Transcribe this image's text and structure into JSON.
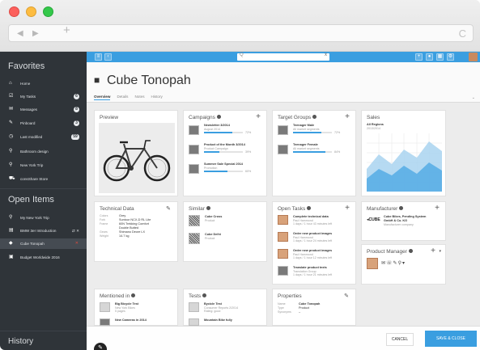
{
  "browser": {
    "back": "◀",
    "forward": "▶",
    "new_tab": "+",
    "reload": "C"
  },
  "sidebar": {
    "favorites_heading": "Favorites",
    "favorites": [
      {
        "icon": "home-icon",
        "glyph": "⌂",
        "label": "Home",
        "badge": ""
      },
      {
        "icon": "tasks-icon",
        "glyph": "☑",
        "label": "My Tasks",
        "badge": "6"
      },
      {
        "icon": "mail-icon",
        "glyph": "✉",
        "label": "Messages",
        "badge": "8"
      },
      {
        "icon": "pin-icon",
        "glyph": "✎",
        "label": "Pinboard",
        "badge": "3"
      },
      {
        "icon": "clock-icon",
        "glyph": "◷",
        "label": "Last modified",
        "badge": "59"
      },
      {
        "icon": "search-icon",
        "glyph": "⚲",
        "label": "Bathroom design",
        "badge": ""
      },
      {
        "icon": "search-icon",
        "glyph": "⚲",
        "label": "New York Trip",
        "badge": ""
      },
      {
        "icon": "cart-icon",
        "glyph": "⛟",
        "label": "consShare Store",
        "badge": ""
      }
    ],
    "open_items_heading": "Open Items",
    "open_items": [
      {
        "icon": "search-icon",
        "glyph": "⚲",
        "label": "My New York Trip"
      },
      {
        "icon": "page-icon",
        "glyph": "▤",
        "label": "BMW 3er Introduction"
      },
      {
        "icon": "cube-icon",
        "glyph": "◆",
        "label": "Cube Tonopah"
      },
      {
        "icon": "report-icon",
        "glyph": "▣",
        "label": "Budget Worldwide 2016"
      }
    ],
    "history_heading": "History"
  },
  "topbar": {
    "search_placeholder": "Q",
    "clear": "x"
  },
  "header": {
    "title": "Cube Tonopah",
    "tabs": [
      "Overview",
      "Details",
      "Notes",
      "History"
    ]
  },
  "cards": {
    "preview": {
      "title": "Preview"
    },
    "campaigns": {
      "title": "Campaigns",
      "items": [
        {
          "name": "Newsletter 3/2014",
          "sub": "August 2014",
          "pct": "72%",
          "fill": 0.72
        },
        {
          "name": "Product of the Month 3/2014",
          "sub": "Product Campaign",
          "pct": "39%",
          "fill": 0.39
        },
        {
          "name": "Summer Sale Special 2014",
          "sub": "Promotion",
          "pct": "60%",
          "fill": 0.6
        }
      ]
    },
    "target_groups": {
      "title": "Target Groups",
      "items": [
        {
          "name": "Teenager Male",
          "sub": "All market segments",
          "pct": "72%",
          "fill": 0.72
        },
        {
          "name": "Teenager Female",
          "sub": "All market segments",
          "pct": "84%",
          "fill": 0.84
        }
      ]
    },
    "sales": {
      "title": "Sales",
      "region": "All Regions",
      "period": "2013/2014"
    },
    "technical": {
      "title": "Technical Data",
      "rows": [
        {
          "k": "Colors",
          "v": "Grey"
        },
        {
          "k": "Fork",
          "v": "Suntour NCX-D RL Lite"
        },
        {
          "k": "Frame",
          "v": "60N Trekking Comfort"
        },
        {
          "k": "",
          "v": "Double Butted"
        },
        {
          "k": "Gears",
          "v": "Shimano Deore LX"
        },
        {
          "k": "Weight",
          "v": "14.7 kg"
        }
      ]
    },
    "similar": {
      "title": "Similar",
      "items": [
        {
          "name": "Cube Cross",
          "sub": "Product"
        },
        {
          "name": "Cube Delhi",
          "sub": "Product"
        }
      ]
    },
    "open_tasks": {
      "title": "Open Tasks",
      "items": [
        {
          "name": "Complete technical data",
          "sub1": "Paul Hammond",
          "sub2": "1 days / 1 hour 43 minutes left"
        },
        {
          "name": "Order new product images",
          "sub1": "Paul Hammond",
          "sub2": "1 days / 1 hour 24 minutes left"
        },
        {
          "name": "Order new product images",
          "sub1": "Paul Hammond",
          "sub2": "1 days / 1 hour 12 minutes left"
        },
        {
          "name": "Translate product texts",
          "sub1": "Translation Group",
          "sub2": "1 days / 1 hour 21 minutes left"
        }
      ]
    },
    "manufacturer": {
      "title": "Manufacturer",
      "name": "Cube Bikes, Pending System",
      "name2": "GmbH & Co. KG",
      "sub": "Manufacturer company"
    },
    "product_manager": {
      "title": "Product Manager"
    },
    "mentioned": {
      "title": "Mentioned in",
      "items": [
        {
          "name": "Big Bicycle Test",
          "sub1": "New York Bikes",
          "sub2": "5 pages"
        },
        {
          "name": "New Cameras in 2014",
          "sub1": "",
          "sub2": ""
        }
      ]
    },
    "tests": {
      "title": "Tests",
      "items": [
        {
          "name": "Bycicle Test",
          "sub1": "Consumer Reports 2/2014",
          "sub2": "Rating: good"
        },
        {
          "name": "Mountain Bike fully",
          "sub1": "",
          "sub2": ""
        }
      ]
    },
    "properties": {
      "title": "Properties",
      "rows": [
        {
          "k": "Name",
          "v": "Cube Tonopah"
        },
        {
          "k": "Type",
          "v": "Product"
        },
        {
          "k": "Synonyms",
          "v": "–"
        }
      ]
    }
  },
  "footer": {
    "cancel": "CANCEL",
    "save": "SAVE & CLOSE"
  },
  "colors": {
    "accent": "#3a9ee0",
    "sidebar": "#2f3439"
  }
}
